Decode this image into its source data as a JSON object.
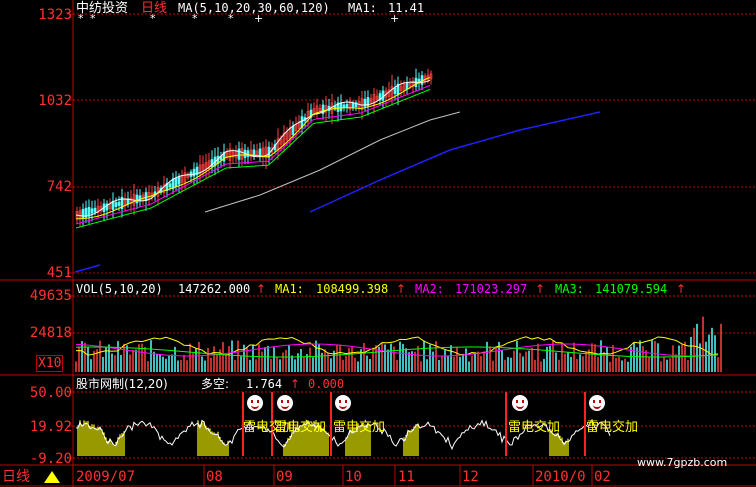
{
  "colors": {
    "frame": "#c00000",
    "up": "#ff4040",
    "down": "#54ffff",
    "ma5": "#ffffff",
    "ma10": "#ffff00",
    "ma20": "#ff00ff",
    "ma30": "#00ff00",
    "ma60": "#c0c0c0",
    "ma120": "#2020ff",
    "signal": "#ffff00"
  },
  "header": {
    "stock_name": "中纺投资",
    "period": "日线",
    "ma_params": "MA(5,10,20,30,60,120)",
    "ma1_label": "MA1:",
    "ma1_value": "11.41"
  },
  "price_axis": {
    "labels": [
      "1323",
      "1032",
      "742",
      "451"
    ]
  },
  "volume_panel": {
    "title": "VOL(5,10,20)",
    "vol_value": "147262.000",
    "ma1_label": "MA1:",
    "ma1_value": "108499.398",
    "ma2_label": "MA2:",
    "ma2_value": "171023.297",
    "ma3_label": "MA3:",
    "ma3_value": "141079.594",
    "axis_labels": [
      "49635",
      "24818"
    ],
    "multiplier": "X10"
  },
  "indicator_panel": {
    "title": "股市网制(12,20)",
    "duokong_label": "多空:",
    "duokong_value": "1.764",
    "second_value": "0.000",
    "axis_labels": [
      "50.00",
      "19.92",
      "-9.20"
    ],
    "signal_text": "雷电交加"
  },
  "bottom_bar": {
    "period_button": "日线",
    "dates": [
      "2009/07",
      "08",
      "09",
      "10",
      "11",
      "12",
      "2010/0",
      "02"
    ]
  },
  "watermark": "www.7gpzb.com",
  "chart_data": {
    "type": "candlestick",
    "title": "中纺投资 日线",
    "yaxis_ticks": [
      451,
      742,
      1032,
      1323
    ],
    "volume_yaxis_ticks": [
      24818,
      49635
    ],
    "indicator_yaxis_ticks": [
      -9.2,
      19.92,
      50.0
    ],
    "x_tick_labels": [
      "2009/07",
      "08",
      "09",
      "10",
      "11",
      "12",
      "2010/0",
      "02"
    ],
    "series": [
      {
        "name": "MA1",
        "last": 11.41
      },
      {
        "name": "VOL",
        "last": 147262.0
      },
      {
        "name": "MA1",
        "last": 108499.398
      },
      {
        "name": "MA2",
        "last": 171023.297
      },
      {
        "name": "MA3",
        "last": 141079.594
      },
      {
        "name": "多空",
        "last": 1.764
      }
    ]
  }
}
